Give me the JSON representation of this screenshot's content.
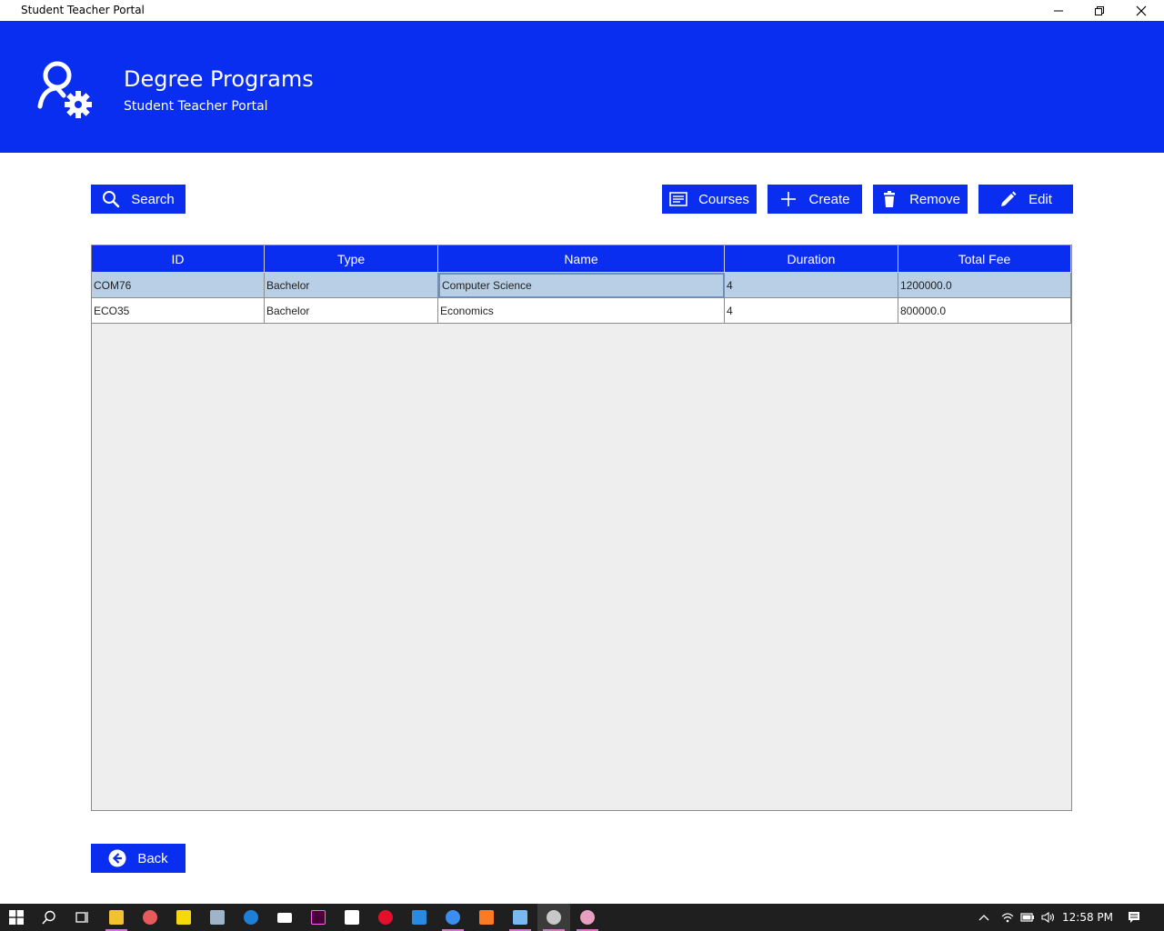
{
  "window": {
    "title": "Student Teacher Portal"
  },
  "header": {
    "title": "Degree Programs",
    "subtitle": "Student Teacher Portal"
  },
  "toolbar": {
    "search_label": "Search",
    "courses_label": "Courses",
    "create_label": "Create",
    "remove_label": "Remove",
    "edit_label": "Edit"
  },
  "table": {
    "columns": [
      "ID",
      "Type",
      "Name",
      "Duration",
      "Total Fee"
    ],
    "rows": [
      [
        "COM76",
        "Bachelor",
        "Computer Science",
        "4",
        "1200000.0"
      ],
      [
        "ECO35",
        "Bachelor",
        "Economics",
        "4",
        "800000.0"
      ]
    ]
  },
  "footer": {
    "back_label": "Back"
  },
  "taskbar": {
    "time": "12:58 PM"
  },
  "colors": {
    "accent": "#0a2ef0",
    "selected_row": "#b8cfe5",
    "table_bg": "#eeeeee",
    "taskbar": "#1f1f1f"
  }
}
